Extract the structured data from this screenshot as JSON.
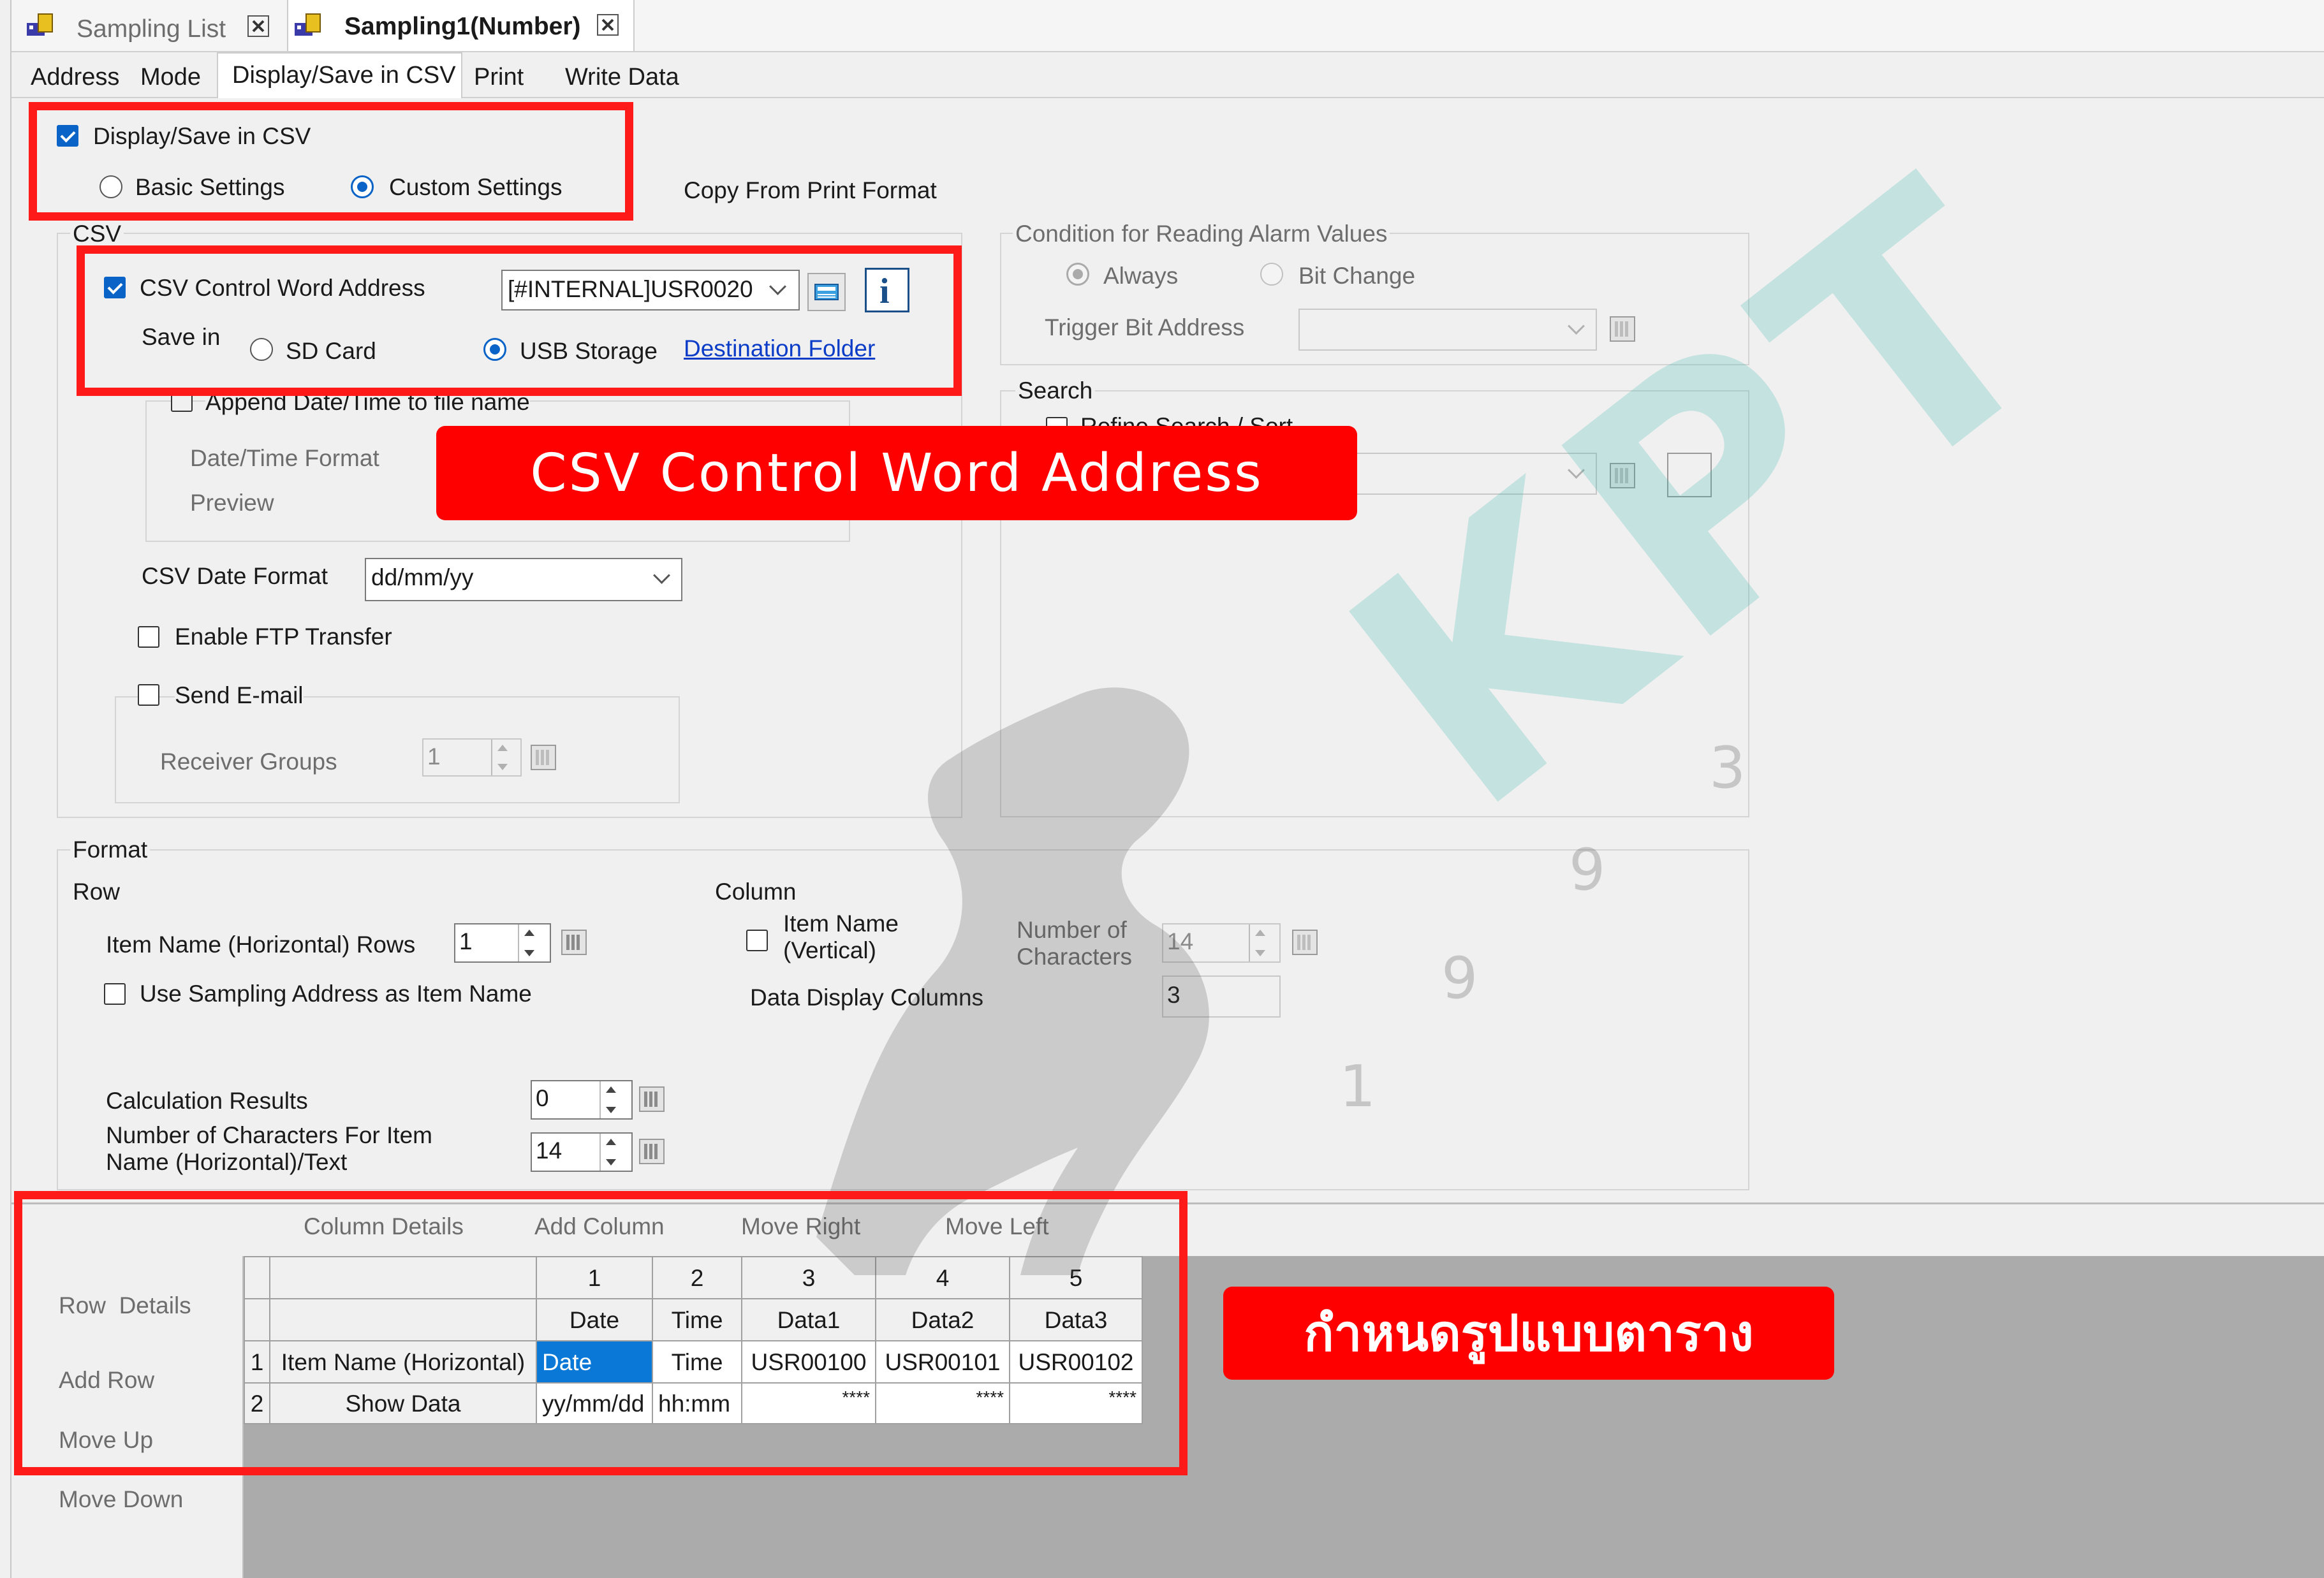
{
  "doc_tabs": [
    {
      "label": "Sampling List",
      "active": false
    },
    {
      "label": "Sampling1(Number)",
      "active": true
    }
  ],
  "settings_tabs": [
    "Address",
    "Mode",
    "Display/Save in CSV",
    "Print",
    "Write Data"
  ],
  "display_save": {
    "checkbox_label": "Display/Save in CSV",
    "checked": true,
    "basic_label": "Basic Settings",
    "custom_label": "Custom Settings",
    "selected": "Custom Settings",
    "copy_link": "Copy From Print Format"
  },
  "csv": {
    "group_label": "CSV",
    "control_word_label": "CSV Control Word Address",
    "control_word_checked": true,
    "control_word_value": "[#INTERNAL]USR0020",
    "info_icon_glyph": "i",
    "save_in_label": "Save in",
    "sd_card_label": "SD Card",
    "usb_label": "USB Storage",
    "save_selected": "USB Storage",
    "destination_link": "Destination Folder",
    "append_datetime_label": "Append Date/Time to file name",
    "datetime_format_label": "Date/Time Format",
    "preview_label": "Preview",
    "date_format_label": "CSV Date Format",
    "date_format_value": "dd/mm/yy",
    "ftp_label": "Enable FTP Transfer",
    "email_label": "Send E-mail",
    "receiver_groups_label": "Receiver Groups",
    "receiver_groups_value": "1"
  },
  "alarm": {
    "group_label": "Condition for Reading Alarm Values",
    "always_label": "Always",
    "bit_change_label": "Bit Change",
    "trigger_label": "Trigger Bit Address"
  },
  "search": {
    "group_label": "Search",
    "refine_label": "Refine Search / Sort"
  },
  "format": {
    "group_label": "Format",
    "row_label": "Row",
    "item_name_rows_label": "Item Name (Horizontal) Rows",
    "item_name_rows_value": "1",
    "use_sampling_label": "Use Sampling Address as Item Name",
    "column_label": "Column",
    "item_name_vertical_line1": "Item Name",
    "item_name_vertical_line2": "(Vertical)",
    "num_chars_line1": "Number of",
    "num_chars_line2": "Characters",
    "num_chars_value": "14",
    "data_display_columns_label": "Data Display Columns",
    "data_display_columns_value": "3",
    "calc_results_label": "Calculation Results",
    "calc_results_value": "0",
    "num_chars_item_line1": "Number of Characters For Item",
    "num_chars_item_line2": "Name (Horizontal)/Text",
    "num_chars_item_value": "14"
  },
  "toolbar": {
    "column_details": "Column Details",
    "add_column": "Add Column",
    "move_right": "Move Right",
    "move_left": "Move Left"
  },
  "row_buttons": {
    "row_details": "Row  Details",
    "add_row": "Add Row",
    "move_up": "Move Up",
    "move_down": "Move Down"
  },
  "grid": {
    "column_numbers": [
      "1",
      "2",
      "3",
      "4",
      "5"
    ],
    "column_types": [
      "Date",
      "Time",
      "Data1",
      "Data2",
      "Data3"
    ],
    "rows": [
      {
        "num": "1",
        "name": "Item Name (Horizontal)",
        "cells": [
          "Date",
          "Time",
          "USR00100",
          "USR00101",
          "USR00102"
        ]
      },
      {
        "num": "2",
        "name": "Show Data",
        "cells": [
          "yy/mm/dd",
          "hh:mm",
          "****",
          "****",
          "****"
        ]
      }
    ]
  },
  "annotations": {
    "csv_banner": "CSV Control Word Address",
    "table_banner": "กำหนดรูปแบบตาราง",
    "highlight_color": "#ff0000"
  },
  "watermark": {
    "text": "KPT",
    "digits": [
      "1",
      "9",
      "9",
      "3"
    ]
  }
}
